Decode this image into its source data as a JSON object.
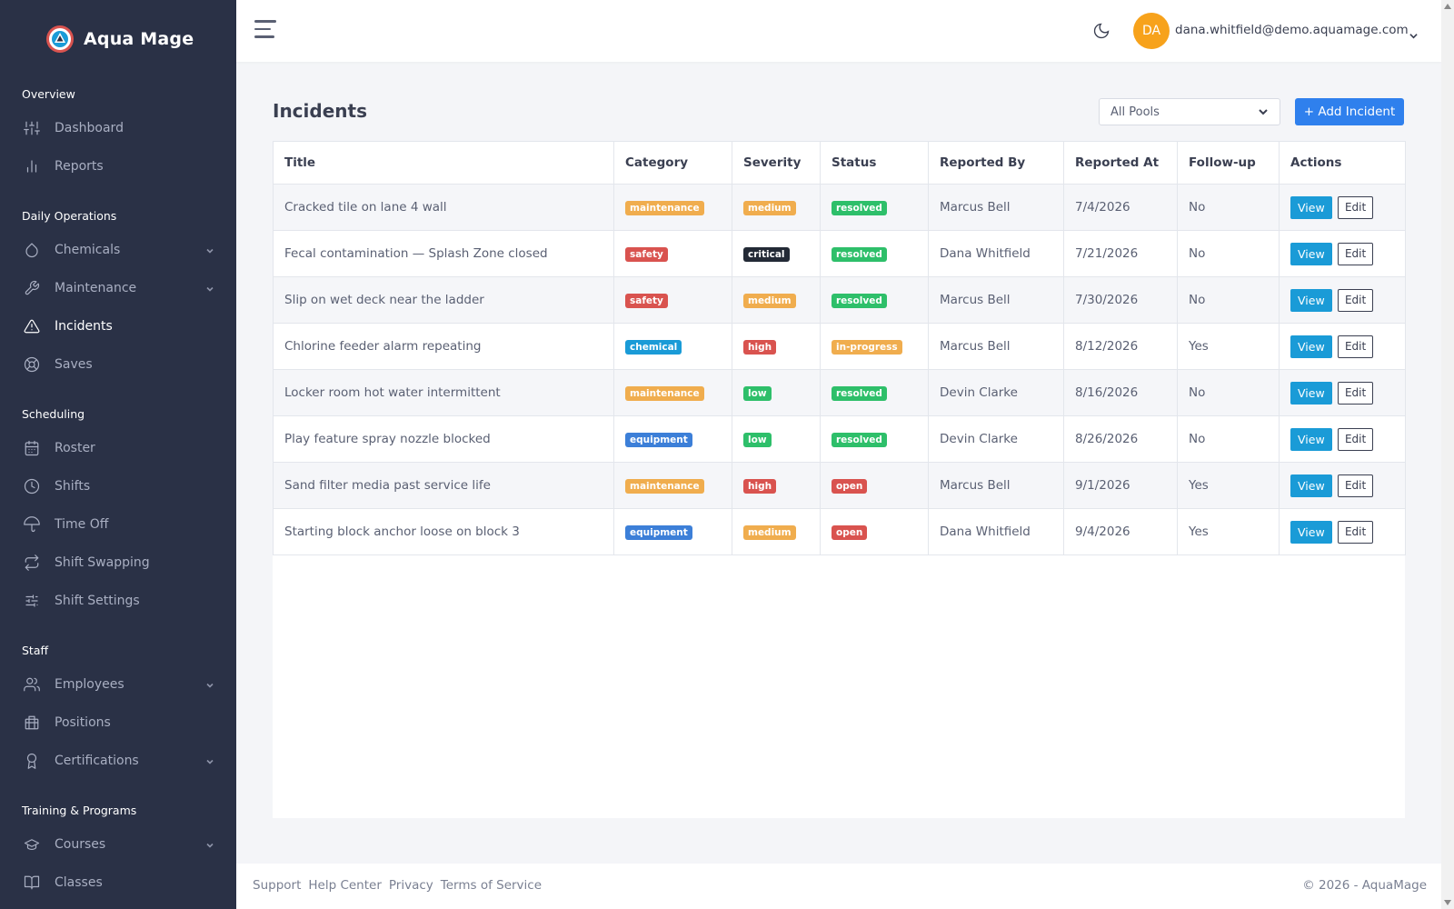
{
  "app": {
    "name": "Aqua Mage"
  },
  "sidebar": {
    "sections": [
      {
        "title": "Overview",
        "items": [
          {
            "label": "Dashboard",
            "icon": "sliders-icon",
            "chevron": false,
            "active": false
          },
          {
            "label": "Reports",
            "icon": "bar-chart-icon",
            "chevron": false,
            "active": false
          }
        ]
      },
      {
        "title": "Daily Operations",
        "items": [
          {
            "label": "Chemicals",
            "icon": "droplet-icon",
            "chevron": true,
            "active": false
          },
          {
            "label": "Maintenance",
            "icon": "wrench-icon",
            "chevron": true,
            "active": false
          },
          {
            "label": "Incidents",
            "icon": "warning-triangle-icon",
            "chevron": false,
            "active": true
          },
          {
            "label": "Saves",
            "icon": "lifebuoy-icon",
            "chevron": false,
            "active": false
          }
        ]
      },
      {
        "title": "Scheduling",
        "items": [
          {
            "label": "Roster",
            "icon": "calendar-icon",
            "chevron": false,
            "active": false
          },
          {
            "label": "Shifts",
            "icon": "clock-icon",
            "chevron": false,
            "active": false
          },
          {
            "label": "Time Off",
            "icon": "umbrella-icon",
            "chevron": false,
            "active": false
          },
          {
            "label": "Shift Swapping",
            "icon": "swap-arrows-icon",
            "chevron": false,
            "active": false
          },
          {
            "label": "Shift Settings",
            "icon": "settings-sliders-icon",
            "chevron": false,
            "active": false
          }
        ]
      },
      {
        "title": "Staff",
        "items": [
          {
            "label": "Employees",
            "icon": "users-icon",
            "chevron": true,
            "active": false
          },
          {
            "label": "Positions",
            "icon": "building-icon",
            "chevron": false,
            "active": false
          },
          {
            "label": "Certifications",
            "icon": "award-icon",
            "chevron": true,
            "active": false
          }
        ]
      },
      {
        "title": "Training & Programs",
        "items": [
          {
            "label": "Courses",
            "icon": "graduation-cap-icon",
            "chevron": true,
            "active": false
          },
          {
            "label": "Classes",
            "icon": "book-icon",
            "chevron": false,
            "active": false
          }
        ]
      }
    ]
  },
  "topbar": {
    "avatar_initials": "DA",
    "user_email": "dana.whitfield@demo.aquamage.com",
    "avatar_color": "#f7a21b"
  },
  "page": {
    "title": "Incidents",
    "pool_filter": "All Pools",
    "add_button": "+ Add Incident"
  },
  "table": {
    "columns": [
      "Title",
      "Category",
      "Severity",
      "Status",
      "Reported By",
      "Reported At",
      "Follow-up",
      "Actions"
    ],
    "view_label": "View",
    "edit_label": "Edit",
    "rows": [
      {
        "title": "Cracked tile on lane 4 wall",
        "category": "maintenance",
        "severity": "medium",
        "status": "resolved",
        "reported_by": "Marcus Bell",
        "reported_at": "7/4/2026",
        "follow_up": "No"
      },
      {
        "title": "Fecal contamination — Splash Zone closed",
        "category": "safety",
        "severity": "critical",
        "status": "resolved",
        "reported_by": "Dana Whitfield",
        "reported_at": "7/21/2026",
        "follow_up": "No"
      },
      {
        "title": "Slip on wet deck near the ladder",
        "category": "safety",
        "severity": "medium",
        "status": "resolved",
        "reported_by": "Marcus Bell",
        "reported_at": "7/30/2026",
        "follow_up": "No"
      },
      {
        "title": "Chlorine feeder alarm repeating",
        "category": "chemical",
        "severity": "high",
        "status": "in-progress",
        "reported_by": "Marcus Bell",
        "reported_at": "8/12/2026",
        "follow_up": "Yes"
      },
      {
        "title": "Locker room hot water intermittent",
        "category": "maintenance",
        "severity": "low",
        "status": "resolved",
        "reported_by": "Devin Clarke",
        "reported_at": "8/16/2026",
        "follow_up": "No"
      },
      {
        "title": "Play feature spray nozzle blocked",
        "category": "equipment",
        "severity": "low",
        "status": "resolved",
        "reported_by": "Devin Clarke",
        "reported_at": "8/26/2026",
        "follow_up": "No"
      },
      {
        "title": "Sand filter media past service life",
        "category": "maintenance",
        "severity": "high",
        "status": "open",
        "reported_by": "Marcus Bell",
        "reported_at": "9/1/2026",
        "follow_up": "Yes"
      },
      {
        "title": "Starting block anchor loose on block 3",
        "category": "equipment",
        "severity": "medium",
        "status": "open",
        "reported_by": "Dana Whitfield",
        "reported_at": "9/4/2026",
        "follow_up": "Yes"
      }
    ]
  },
  "footer": {
    "links": [
      "Support",
      "Help Center",
      "Privacy",
      "Terms of Service"
    ],
    "copyright": "© 2026 - AquaMage"
  },
  "colors": {
    "sidebar_bg": "#2a3146",
    "primary": "#2f80ed",
    "info": "#1a9bd7",
    "success": "#2ebf6a",
    "warning": "#f0ad4e",
    "danger": "#d9534f",
    "dark": "#232a36"
  }
}
